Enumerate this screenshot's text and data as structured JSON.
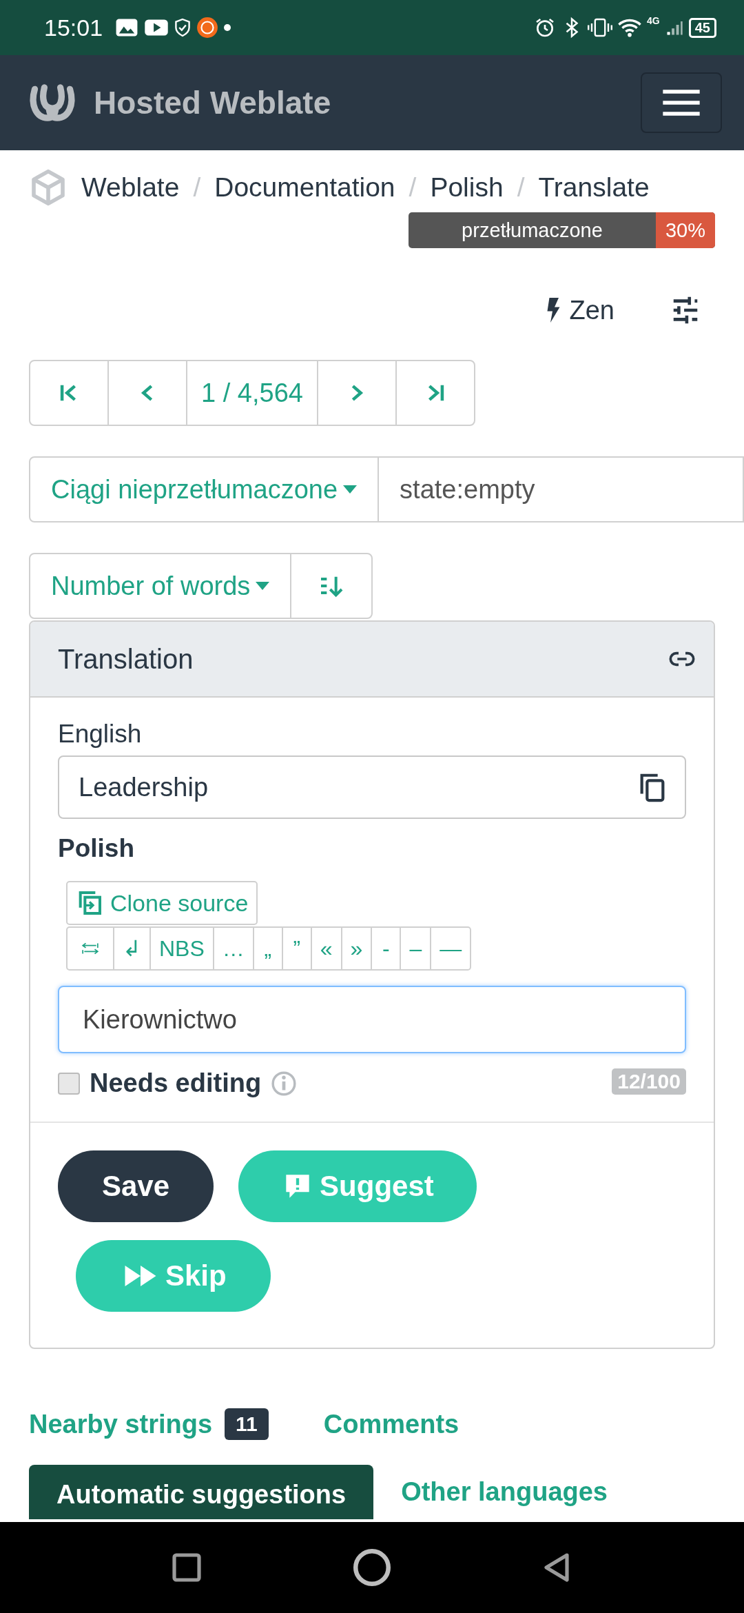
{
  "status_bar": {
    "time": "15:01",
    "network": "4G",
    "battery": "45"
  },
  "header": {
    "title": "Hosted Weblate"
  },
  "breadcrumb": [
    {
      "label": "Weblate"
    },
    {
      "separator": "/",
      "label": "Documentation"
    },
    {
      "separator": "/",
      "label": "Polish"
    },
    {
      "separator": "/",
      "label": "Translate"
    }
  ],
  "progress": {
    "label": "przetłumaczone",
    "percent": "30%"
  },
  "toolbar": {
    "zen": "Zen"
  },
  "navigation": {
    "counter": "1 / 4,564"
  },
  "filter": {
    "dropdown": "Ciągi nieprzetłumaczone",
    "query": "state:empty"
  },
  "sort": {
    "dropdown": "Number of words"
  },
  "translation": {
    "title": "Translation",
    "source_label": "English",
    "source_text": "Leadership",
    "target_label": "Polish",
    "clone": "Clone source",
    "special_chars": [
      {
        "kind": "tab"
      },
      {
        "kind": "text",
        "text": "↲"
      },
      {
        "kind": "text",
        "text": "NBS"
      },
      {
        "kind": "text",
        "text": "…"
      },
      {
        "kind": "text",
        "text": "„"
      },
      {
        "kind": "text",
        "text": "”"
      },
      {
        "kind": "text",
        "text": "«"
      },
      {
        "kind": "text",
        "text": "»"
      },
      {
        "kind": "text",
        "text": "-"
      },
      {
        "kind": "text",
        "text": "–"
      },
      {
        "kind": "text",
        "text": "—"
      }
    ],
    "target_text": "Kierownictwo",
    "needs_editing": {
      "label": "Needs editing",
      "checked": false
    },
    "length": "12/100",
    "buttons": [
      {
        "kind": "save",
        "label": "Save"
      },
      {
        "kind": "suggest",
        "label": "Suggest"
      },
      {
        "kind": "skip",
        "label": "Skip"
      }
    ]
  },
  "tabs": [
    {
      "label": "Nearby strings",
      "badge": "11",
      "selected": false
    },
    {
      "label": "Comments",
      "selected": false
    },
    {
      "label": "Automatic suggestions",
      "selected": true
    },
    {
      "label": "Other languages",
      "selected": false
    }
  ]
}
